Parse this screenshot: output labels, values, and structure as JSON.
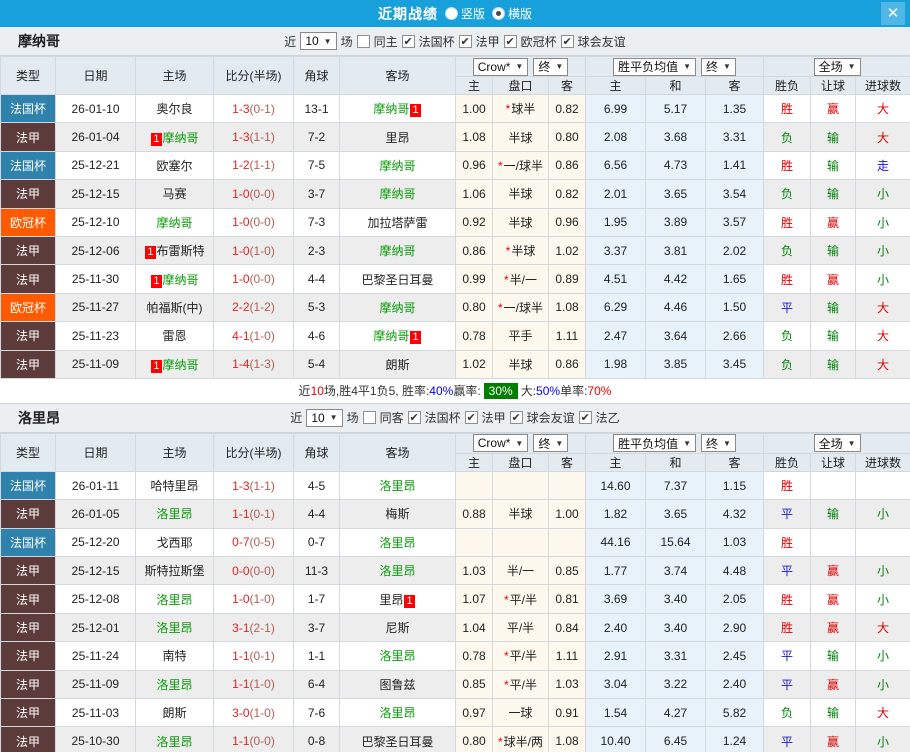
{
  "titlebar": {
    "title": "近期战绩",
    "radio_vertical": "竖版",
    "radio_horizontal": "横版",
    "close_glyph": "✕"
  },
  "columns": {
    "type": "类型",
    "date": "日期",
    "home": "主场",
    "score": "比分(半场)",
    "corner": "角球",
    "away": "客场",
    "c_home": "主",
    "handicap": "盘口",
    "c_away": "客",
    "e_home": "主",
    "e_draw": "和",
    "e_away": "客",
    "result": "胜负",
    "let_result": "让球",
    "goals": "进球数"
  },
  "selects": {
    "company": "Crow*",
    "final": "终",
    "avg": "胜平负均值",
    "full": "全场"
  },
  "filter_words": {
    "near": "近",
    "games": "场"
  },
  "palette": {
    "titlebar": "#18a0da",
    "close_btn": "#51b7e6",
    "header_bg": "#e3eaf0",
    "section_bg": "#ebeff2",
    "alt_row": "#ededed",
    "cream": "#fcf8ee",
    "light_blue": "#e7f2fa",
    "win_red": "#dd0000",
    "lose_green": "#00820a",
    "draw_blue": "#1717cf",
    "team_green": "#0a9b0a",
    "score_red": "#e62222",
    "half_red": "#b25f55",
    "badge_red": "#fe0000",
    "type_colors": {
      "法国杯": "#2e82ac",
      "法甲": "#5e3b3b",
      "欧冠杯": "#ff5a00"
    }
  },
  "sections": [
    {
      "team": "摩纳哥",
      "filter": {
        "count": "10",
        "same_checked": false,
        "same_label": "同主",
        "leagues": [
          "法国杯",
          "法甲",
          "欧冠杯",
          "球会友谊"
        ]
      },
      "rows": [
        {
          "type": "法国杯",
          "date": "26-01-10",
          "home": "奥尔良",
          "hg": false,
          "hb": "",
          "score": "1-3",
          "half": "(0-1)",
          "corner": "13-1",
          "away": "摩纳哥",
          "ag": true,
          "ab": "1",
          "crown": [
            "1.00",
            "*球半",
            "0.82"
          ],
          "euro": [
            "6.99",
            "5.17",
            "1.35"
          ],
          "res": [
            "胜",
            "赢",
            "大"
          ]
        },
        {
          "type": "法甲",
          "date": "26-01-04",
          "home": "摩纳哥",
          "hg": true,
          "hb": "1",
          "score": "1-3",
          "half": "(1-1)",
          "corner": "7-2",
          "away": "里昂",
          "ag": false,
          "ab": "",
          "crown": [
            "1.08",
            "半球",
            "0.80"
          ],
          "euro": [
            "2.08",
            "3.68",
            "3.31"
          ],
          "res": [
            "负",
            "输",
            "大"
          ]
        },
        {
          "type": "法国杯",
          "date": "25-12-21",
          "home": "欧塞尔",
          "hg": false,
          "hb": "",
          "score": "1-2",
          "half": "(1-1)",
          "corner": "7-5",
          "away": "摩纳哥",
          "ag": true,
          "ab": "",
          "crown": [
            "0.96",
            "*一/球半",
            "0.86"
          ],
          "euro": [
            "6.56",
            "4.73",
            "1.41"
          ],
          "res": [
            "胜",
            "输",
            "走"
          ]
        },
        {
          "type": "法甲",
          "date": "25-12-15",
          "home": "马赛",
          "hg": false,
          "hb": "",
          "score": "1-0",
          "half": "(0-0)",
          "corner": "3-7",
          "away": "摩纳哥",
          "ag": true,
          "ab": "",
          "crown": [
            "1.06",
            "半球",
            "0.82"
          ],
          "euro": [
            "2.01",
            "3.65",
            "3.54"
          ],
          "res": [
            "负",
            "输",
            "小"
          ]
        },
        {
          "type": "欧冠杯",
          "date": "25-12-10",
          "home": "摩纳哥",
          "hg": true,
          "hb": "",
          "score": "1-0",
          "half": "(0-0)",
          "corner": "7-3",
          "away": "加拉塔萨雷",
          "ag": false,
          "ab": "",
          "crown": [
            "0.92",
            "半球",
            "0.96"
          ],
          "euro": [
            "1.95",
            "3.89",
            "3.57"
          ],
          "res": [
            "胜",
            "赢",
            "小"
          ]
        },
        {
          "type": "法甲",
          "date": "25-12-06",
          "home": "布雷斯特",
          "hg": false,
          "hb": "1",
          "score": "1-0",
          "half": "(1-0)",
          "corner": "2-3",
          "away": "摩纳哥",
          "ag": true,
          "ab": "",
          "crown": [
            "0.86",
            "*半球",
            "1.02"
          ],
          "euro": [
            "3.37",
            "3.81",
            "2.02"
          ],
          "res": [
            "负",
            "输",
            "小"
          ]
        },
        {
          "type": "法甲",
          "date": "25-11-30",
          "home": "摩纳哥",
          "hg": true,
          "hb": "1",
          "score": "1-0",
          "half": "(0-0)",
          "corner": "4-4",
          "away": "巴黎圣日耳曼",
          "ag": false,
          "ab": "",
          "crown": [
            "0.99",
            "*半/一",
            "0.89"
          ],
          "euro": [
            "4.51",
            "4.42",
            "1.65"
          ],
          "res": [
            "胜",
            "赢",
            "小"
          ]
        },
        {
          "type": "欧冠杯",
          "date": "25-11-27",
          "home": "帕福斯(中)",
          "hg": false,
          "hb": "",
          "score": "2-2",
          "half": "(1-2)",
          "corner": "5-3",
          "away": "摩纳哥",
          "ag": true,
          "ab": "",
          "crown": [
            "0.80",
            "*一/球半",
            "1.08"
          ],
          "euro": [
            "6.29",
            "4.46",
            "1.50"
          ],
          "res": [
            "平",
            "输",
            "大"
          ]
        },
        {
          "type": "法甲",
          "date": "25-11-23",
          "home": "雷恩",
          "hg": false,
          "hb": "",
          "score": "4-1",
          "half": "(1-0)",
          "corner": "4-6",
          "away": "摩纳哥",
          "ag": true,
          "ab": "1",
          "crown": [
            "0.78",
            "平手",
            "1.11"
          ],
          "euro": [
            "2.47",
            "3.64",
            "2.66"
          ],
          "res": [
            "负",
            "输",
            "大"
          ]
        },
        {
          "type": "法甲",
          "date": "25-11-09",
          "home": "摩纳哥",
          "hg": true,
          "hb": "1",
          "score": "1-4",
          "half": "(1-3)",
          "corner": "5-4",
          "away": "朗斯",
          "ag": false,
          "ab": "",
          "crown": [
            "1.02",
            "半球",
            "0.86"
          ],
          "euro": [
            "1.98",
            "3.85",
            "3.45"
          ],
          "res": [
            "负",
            "输",
            "大"
          ]
        }
      ],
      "summary": [
        {
          "t": "近",
          "k": "plain"
        },
        {
          "t": "10",
          "k": "red"
        },
        {
          "t": "场,胜4平1负5, 胜率:",
          "k": "plain"
        },
        {
          "t": "40%",
          "k": "blue"
        },
        {
          "t": " 赢率:",
          "k": "plain"
        },
        {
          "t": "30%",
          "k": "greenbox"
        },
        {
          "t": " 大:",
          "k": "plain"
        },
        {
          "t": "50%",
          "k": "blue"
        },
        {
          "t": " 单率:",
          "k": "plain"
        },
        {
          "t": "70%",
          "k": "red"
        }
      ]
    },
    {
      "team": "洛里昂",
      "filter": {
        "count": "10",
        "same_checked": false,
        "same_label": "同客",
        "leagues": [
          "法国杯",
          "法甲",
          "球会友谊",
          "法乙"
        ]
      },
      "rows": [
        {
          "type": "法国杯",
          "date": "26-01-11",
          "home": "哈特里昂",
          "hg": false,
          "hb": "",
          "score": "1-3",
          "half": "(1-1)",
          "corner": "4-5",
          "away": "洛里昂",
          "ag": true,
          "ab": "",
          "crown": [
            "",
            "",
            ""
          ],
          "euro": [
            "14.60",
            "7.37",
            "1.15"
          ],
          "res": [
            "胜",
            "",
            ""
          ]
        },
        {
          "type": "法甲",
          "date": "26-01-05",
          "home": "洛里昂",
          "hg": true,
          "hb": "",
          "score": "1-1",
          "half": "(0-1)",
          "corner": "4-4",
          "away": "梅斯",
          "ag": false,
          "ab": "",
          "crown": [
            "0.88",
            "半球",
            "1.00"
          ],
          "euro": [
            "1.82",
            "3.65",
            "4.32"
          ],
          "res": [
            "平",
            "输",
            "小"
          ]
        },
        {
          "type": "法国杯",
          "date": "25-12-20",
          "home": "戈西耶",
          "hg": false,
          "hb": "",
          "score": "0-7",
          "half": "(0-5)",
          "corner": "0-7",
          "away": "洛里昂",
          "ag": true,
          "ab": "",
          "crown": [
            "",
            "",
            ""
          ],
          "euro": [
            "44.16",
            "15.64",
            "1.03"
          ],
          "res": [
            "胜",
            "",
            ""
          ]
        },
        {
          "type": "法甲",
          "date": "25-12-15",
          "home": "斯特拉斯堡",
          "hg": false,
          "hb": "",
          "score": "0-0",
          "half": "(0-0)",
          "corner": "11-3",
          "away": "洛里昂",
          "ag": true,
          "ab": "",
          "crown": [
            "1.03",
            "半/一",
            "0.85"
          ],
          "euro": [
            "1.77",
            "3.74",
            "4.48"
          ],
          "res": [
            "平",
            "赢",
            "小"
          ]
        },
        {
          "type": "法甲",
          "date": "25-12-08",
          "home": "洛里昂",
          "hg": true,
          "hb": "",
          "score": "1-0",
          "half": "(1-0)",
          "corner": "1-7",
          "away": "里昂",
          "ag": false,
          "ab": "1",
          "crown": [
            "1.07",
            "*平/半",
            "0.81"
          ],
          "euro": [
            "3.69",
            "3.40",
            "2.05"
          ],
          "res": [
            "胜",
            "赢",
            "小"
          ]
        },
        {
          "type": "法甲",
          "date": "25-12-01",
          "home": "洛里昂",
          "hg": true,
          "hb": "",
          "score": "3-1",
          "half": "(2-1)",
          "corner": "3-7",
          "away": "尼斯",
          "ag": false,
          "ab": "",
          "crown": [
            "1.04",
            "平/半",
            "0.84"
          ],
          "euro": [
            "2.40",
            "3.40",
            "2.90"
          ],
          "res": [
            "胜",
            "赢",
            "大"
          ]
        },
        {
          "type": "法甲",
          "date": "25-11-24",
          "home": "南特",
          "hg": false,
          "hb": "",
          "score": "1-1",
          "half": "(0-1)",
          "corner": "1-1",
          "away": "洛里昂",
          "ag": true,
          "ab": "",
          "crown": [
            "0.78",
            "*平/半",
            "1.11"
          ],
          "euro": [
            "2.91",
            "3.31",
            "2.45"
          ],
          "res": [
            "平",
            "输",
            "小"
          ]
        },
        {
          "type": "法甲",
          "date": "25-11-09",
          "home": "洛里昂",
          "hg": true,
          "hb": "",
          "score": "1-1",
          "half": "(1-0)",
          "corner": "6-4",
          "away": "图鲁兹",
          "ag": false,
          "ab": "",
          "crown": [
            "0.85",
            "*平/半",
            "1.03"
          ],
          "euro": [
            "3.04",
            "3.22",
            "2.40"
          ],
          "res": [
            "平",
            "赢",
            "小"
          ]
        },
        {
          "type": "法甲",
          "date": "25-11-03",
          "home": "朗斯",
          "hg": false,
          "hb": "",
          "score": "3-0",
          "half": "(1-0)",
          "corner": "7-6",
          "away": "洛里昂",
          "ag": true,
          "ab": "",
          "crown": [
            "0.97",
            "一球",
            "0.91"
          ],
          "euro": [
            "1.54",
            "4.27",
            "5.82"
          ],
          "res": [
            "负",
            "输",
            "大"
          ]
        },
        {
          "type": "法甲",
          "date": "25-10-30",
          "home": "洛里昂",
          "hg": true,
          "hb": "",
          "score": "1-1",
          "half": "(0-0)",
          "corner": "0-8",
          "away": "巴黎圣日耳曼",
          "ag": false,
          "ab": "",
          "crown": [
            "0.80",
            "*球半/两",
            "1.08"
          ],
          "euro": [
            "10.40",
            "6.45",
            "1.24"
          ],
          "res": [
            "平",
            "赢",
            "小"
          ]
        }
      ],
      "summary": null
    }
  ]
}
